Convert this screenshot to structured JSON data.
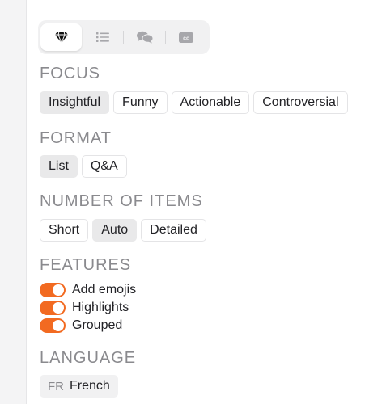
{
  "tabs": [
    {
      "icon": "diamond-icon",
      "active": true
    },
    {
      "icon": "list-icon",
      "active": false
    },
    {
      "icon": "chat-bubbles-icon",
      "active": false
    },
    {
      "icon": "closed-captions-icon",
      "active": false
    }
  ],
  "focus": {
    "title": "FOCUS",
    "options": [
      "Insightful",
      "Funny",
      "Actionable",
      "Controversial"
    ],
    "selected": "Insightful"
  },
  "format": {
    "title": "FORMAT",
    "options": [
      "List",
      "Q&A"
    ],
    "selected": "List"
  },
  "number_of_items": {
    "title": "NUMBER OF ITEMS",
    "options": [
      "Short",
      "Auto",
      "Detailed"
    ],
    "selected": "Auto"
  },
  "features": {
    "title": "FEATURES",
    "items": [
      {
        "label": "Add emojis",
        "on": true
      },
      {
        "label": "Highlights",
        "on": true
      },
      {
        "label": "Grouped",
        "on": true
      }
    ]
  },
  "language": {
    "title": "LANGUAGE",
    "code": "FR",
    "name": "French"
  },
  "colors": {
    "accent": "#f26a21",
    "chip_selected": "#e9e9ea",
    "section_title": "#8a8a8e"
  }
}
